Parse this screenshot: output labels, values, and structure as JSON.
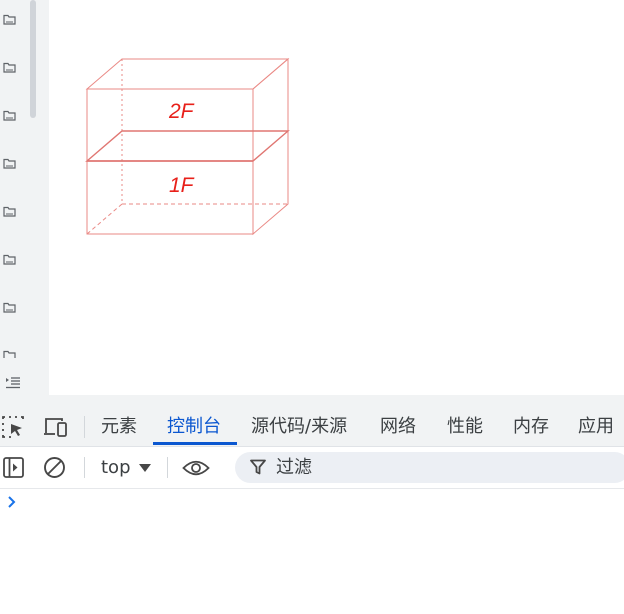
{
  "canvas": {
    "floors": [
      {
        "label": "2F"
      },
      {
        "label": "1F"
      }
    ],
    "colors": {
      "edge": "#ea8a86",
      "label": "#e8201a"
    }
  },
  "sidebar": {
    "item_icon": "folder-icon",
    "item_count": 8,
    "bottom_icon": "indent-icon"
  },
  "devtools": {
    "tabs": [
      {
        "label": "元素"
      },
      {
        "label": "控制台",
        "active": true
      },
      {
        "label": "源代码/来源"
      },
      {
        "label": "网络"
      },
      {
        "label": "性能"
      },
      {
        "label": "内存"
      },
      {
        "label": "应用"
      }
    ],
    "toolbar_icons": [
      "inspect-icon",
      "device-toggle-icon"
    ],
    "console": {
      "context": "top",
      "filter_placeholder": "过滤",
      "icons": [
        "sidebar-toggle-icon",
        "clear-console-icon",
        "eye-icon",
        "filter-icon",
        "prompt-chevron-icon"
      ]
    },
    "accent_color": "#0b57d0"
  }
}
